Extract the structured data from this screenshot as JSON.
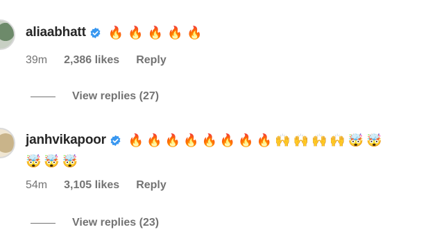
{
  "comments": [
    {
      "username": "aliaabhatt",
      "text": "🔥🔥🔥🔥🔥",
      "text_line2": "",
      "time": "39m",
      "likes": "2,386 likes",
      "reply": "Reply",
      "view_replies": "View replies (27)"
    },
    {
      "username": "janhvikapoor",
      "text": "🔥🔥🔥🔥🔥🔥🔥🔥🙌🙌🙌🙌🤯🤯",
      "text_line2": "🤯🤯🤯",
      "time": "54m",
      "likes": "3,105 likes",
      "reply": "Reply",
      "view_replies": "View replies (23)"
    }
  ],
  "icons": {
    "verified": "verified-badge-icon",
    "accent": "#3897f0"
  }
}
